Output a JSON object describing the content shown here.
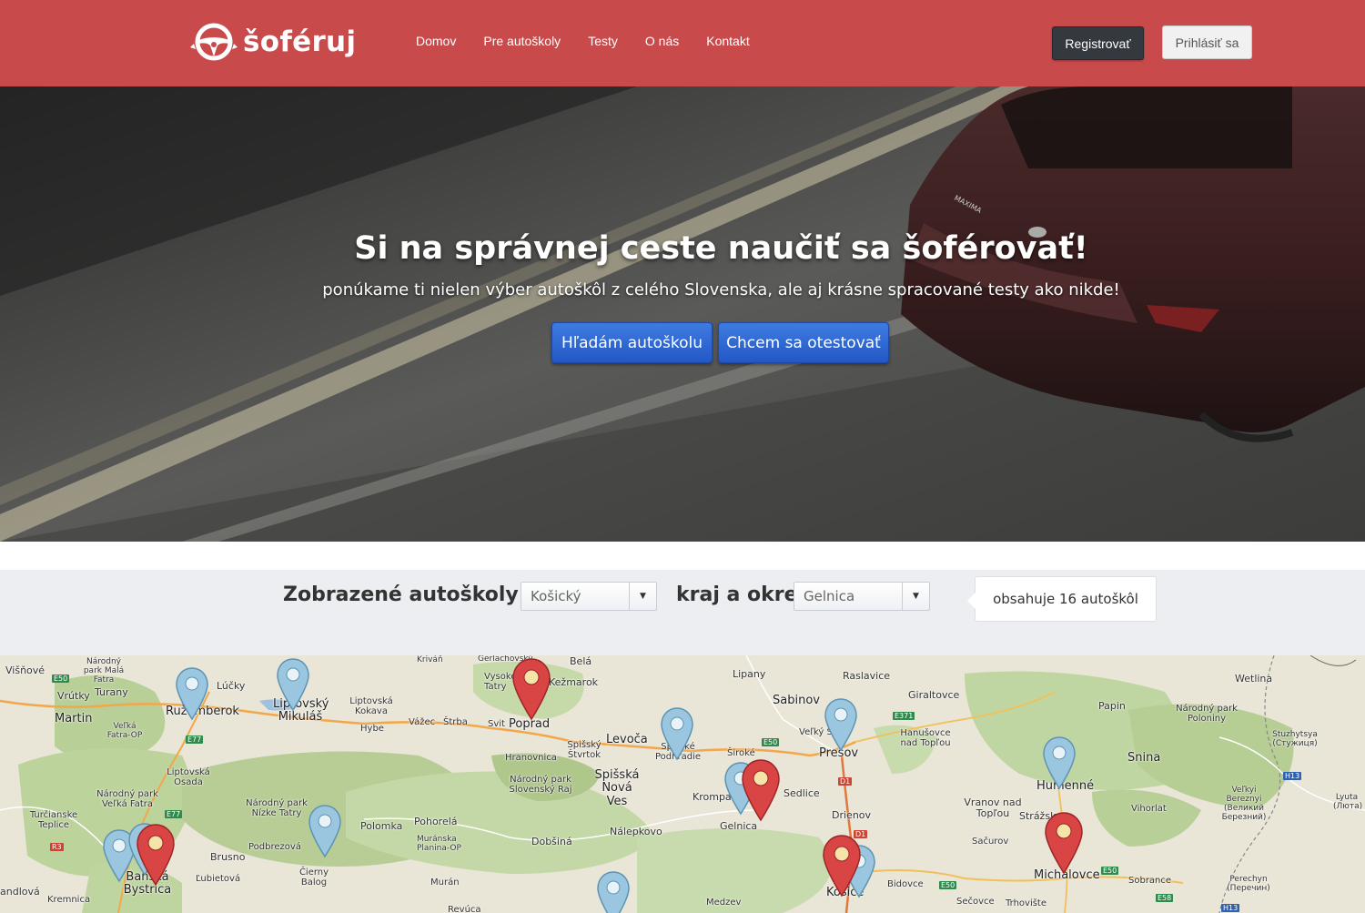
{
  "header": {
    "logo_text": "šoféruj",
    "nav": [
      "Domov",
      "Pre autoškoly",
      "Testy",
      "O nás",
      "Kontakt"
    ],
    "register_label": "Registrovať",
    "login_label": "Prihlásiť sa",
    "colors": {
      "bar": "#c94a4b",
      "register_bg": "#34383f"
    }
  },
  "hero": {
    "title": "Si na správnej ceste naučiť sa šoférovať!",
    "subtitle": "ponúkame ti nielen výber autoškôl z celého Slovenska, ale aj krásne spracované testy ako nikde!",
    "primary_button": "Hľadám autoškolu",
    "secondary_button": "Chcem sa otestovať",
    "car_badge": "MAXIMA"
  },
  "filter": {
    "label_prefix": "Zobrazené autoškoly pre",
    "region_value": "Košický",
    "label_middle": "kraj a okres",
    "district_value": "Gelnica",
    "count_text": "obsahuje 16 autoškôl"
  },
  "map": {
    "places": [
      {
        "n": "Višňové",
        "big": false
      },
      {
        "n": "Národný park Malá Fatra",
        "big": false
      },
      {
        "n": "Vrútky",
        "big": false
      },
      {
        "n": "Turany",
        "big": false
      },
      {
        "n": "Martin",
        "big": true
      },
      {
        "n": "Veľká Fatra-OP",
        "big": false
      },
      {
        "n": "Lúčky",
        "big": false
      },
      {
        "n": "Ružomberok",
        "big": true
      },
      {
        "n": "Liptovský Mikuláš",
        "big": true
      },
      {
        "n": "Liptovská Kokava",
        "big": false
      },
      {
        "n": "Hybe",
        "big": false
      },
      {
        "n": "Vážec",
        "big": false
      },
      {
        "n": "Štrba",
        "big": false
      },
      {
        "n": "Kriváň",
        "big": false
      },
      {
        "n": "Gerlachovský",
        "big": false
      },
      {
        "n": "Vysoké Tatry",
        "big": false
      },
      {
        "n": "Svit",
        "big": false
      },
      {
        "n": "Poprad",
        "big": true
      },
      {
        "n": "Kežmarok",
        "big": false
      },
      {
        "n": "Belá",
        "big": false
      },
      {
        "n": "Lipany",
        "big": false
      },
      {
        "n": "Raslavice",
        "big": false
      },
      {
        "n": "Sabinov",
        "big": false
      },
      {
        "n": "Giraltovce",
        "big": false
      },
      {
        "n": "Wetlina",
        "big": false
      },
      {
        "n": "Papin",
        "big": false
      },
      {
        "n": "Národný park Poloniny",
        "big": false
      },
      {
        "n": "Liptovská Osada",
        "big": false
      },
      {
        "n": "Národný park Veľká Fatra",
        "big": false
      },
      {
        "n": "Národný park Nízke Tatry",
        "big": false
      },
      {
        "n": "Turčianske Teplice",
        "big": false
      },
      {
        "n": "Levoča",
        "big": false
      },
      {
        "n": "Spišský Štvrtok",
        "big": false
      },
      {
        "n": "Hranovnica",
        "big": false
      },
      {
        "n": "Spišské Podhradie",
        "big": false
      },
      {
        "n": "Široké",
        "big": false
      },
      {
        "n": "Veľký Šariš",
        "big": false
      },
      {
        "n": "Prešov",
        "big": true
      },
      {
        "n": "Hanušovce nad Topľou",
        "big": false
      },
      {
        "n": "Národný park Slovenský Raj",
        "big": false
      },
      {
        "n": "Spišská Nová Ves",
        "big": true
      },
      {
        "n": "Krompachy",
        "big": false
      },
      {
        "n": "Sedlice",
        "big": false
      },
      {
        "n": "Humenné",
        "big": true
      },
      {
        "n": "Snina",
        "big": true
      },
      {
        "n": "Stuzhytsya (Стужиця)",
        "big": false
      },
      {
        "n": "Veľkyi Bereznyi (Великий Березний)",
        "big": false
      },
      {
        "n": "Lyuta (Люта)",
        "big": false
      },
      {
        "n": "Polomka",
        "big": false
      },
      {
        "n": "Pohorelá",
        "big": false
      },
      {
        "n": "Muránska Planina-OP",
        "big": false
      },
      {
        "n": "Nálepkovo",
        "big": false
      },
      {
        "n": "Gelnica",
        "big": false
      },
      {
        "n": "Drienov",
        "big": false
      },
      {
        "n": "Vranov nad Topľou",
        "big": false
      },
      {
        "n": "Strážske",
        "big": false
      },
      {
        "n": "Vihorlat",
        "big": false
      },
      {
        "n": "Sačurov",
        "big": false
      },
      {
        "n": "Banská Bystrica",
        "big": true
      },
      {
        "n": "Brusno",
        "big": false
      },
      {
        "n": "Podbrezová",
        "big": false
      },
      {
        "n": "Ľubietová",
        "big": false
      },
      {
        "n": "Čierny Balog",
        "big": false
      },
      {
        "n": "Dobšiná",
        "big": false
      },
      {
        "n": "Murán",
        "big": false
      },
      {
        "n": "Košice",
        "big": true
      },
      {
        "n": "Bidovce",
        "big": false
      },
      {
        "n": "Michalovce",
        "big": true
      },
      {
        "n": "Sobrance",
        "big": false
      },
      {
        "n": "Perechyn (Перечин)",
        "big": false
      },
      {
        "n": "Sečovce",
        "big": false
      },
      {
        "n": "Trhovište",
        "big": false
      },
      {
        "n": "Medzev",
        "big": false
      },
      {
        "n": "Kremnica",
        "big": false
      },
      {
        "n": "andlová",
        "big": false
      },
      {
        "n": "Revúca",
        "big": false
      }
    ],
    "roads": [
      "E50",
      "E77",
      "E371",
      "E50",
      "D1",
      "D1",
      "E77",
      "R3",
      "H13",
      "E50",
      "E50",
      "E58",
      "H13"
    ]
  }
}
